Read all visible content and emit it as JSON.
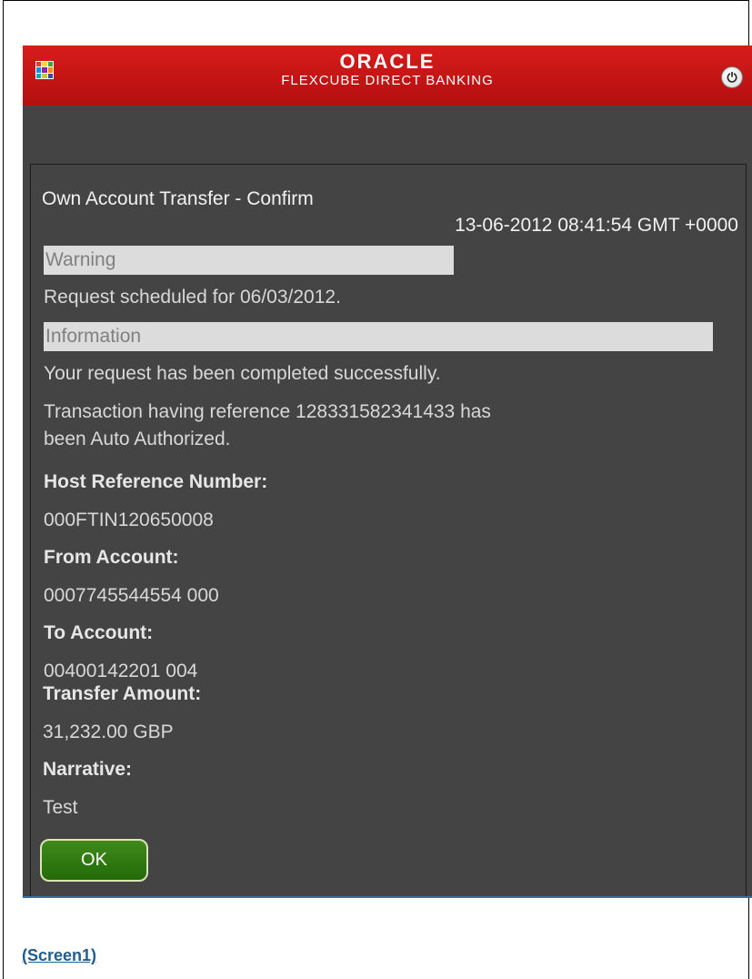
{
  "header": {
    "brand": "ORACLE",
    "subtitle": "FLEXCUBE DIRECT BANKING",
    "menu_icon": "grid-menu-icon",
    "power_icon": "power-icon"
  },
  "page": {
    "title": "Own Account Transfer - Confirm",
    "timestamp": "13-06-2012 08:41:54 GMT +0000"
  },
  "warning": {
    "heading": "Warning",
    "message": "Request scheduled for 06/03/2012."
  },
  "information": {
    "heading": "Information",
    "message1": "Your request has been completed successfully.",
    "message2_line1": "Transaction having reference 128331582341433 has",
    "message2_line2": "been Auto Authorized."
  },
  "details": {
    "host_ref_label": "Host Reference Number:",
    "host_ref_value": "000FTIN120650008",
    "from_label": "From Account:",
    "from_value": "0007745544554 000",
    "to_label": "To Account:",
    "to_value": "00400142201 004",
    "amount_label": "Transfer Amount:",
    "amount_value": "31,232.00 GBP",
    "narrative_label": "Narrative:",
    "narrative_value": "Test"
  },
  "actions": {
    "ok_label": "OK"
  },
  "caption": "(Screen1)",
  "colors": {
    "header_red": "#d81c1c",
    "panel": "#444444",
    "ok_green": "#2f7a10"
  }
}
